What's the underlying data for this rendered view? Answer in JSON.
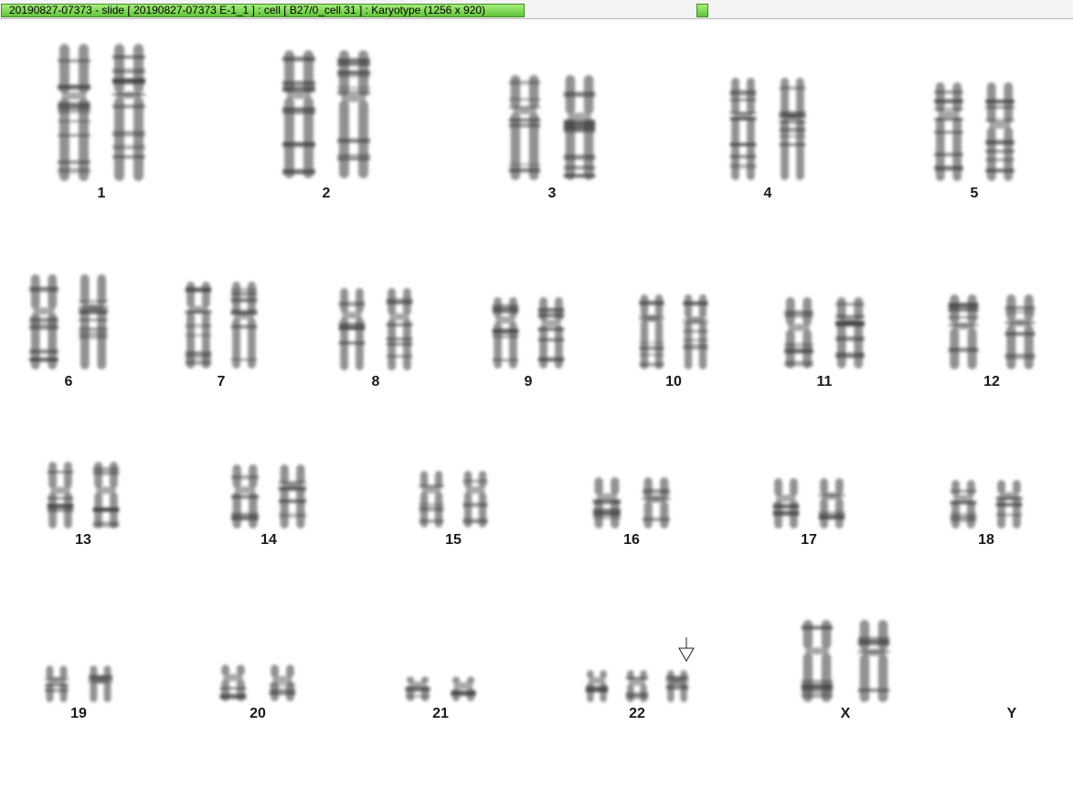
{
  "title_bar": {
    "text": "20190827-07373 - slide [ 20190827-07373 E-1_1 ] : cell [ B27/0_cell 31 ] : Karyotype  (1256 x 920)",
    "progress_color": "#6fd146"
  },
  "karyotype": {
    "pairs": [
      {
        "label": "1"
      },
      {
        "label": "2"
      },
      {
        "label": "3"
      },
      {
        "label": "4"
      },
      {
        "label": "5"
      },
      {
        "label": "6"
      },
      {
        "label": "7"
      },
      {
        "label": "8"
      },
      {
        "label": "9"
      },
      {
        "label": "10"
      },
      {
        "label": "11"
      },
      {
        "label": "12"
      },
      {
        "label": "13"
      },
      {
        "label": "14"
      },
      {
        "label": "15"
      },
      {
        "label": "16"
      },
      {
        "label": "17"
      },
      {
        "label": "18"
      },
      {
        "label": "19"
      },
      {
        "label": "20"
      },
      {
        "label": "21"
      },
      {
        "label": "22"
      },
      {
        "label": "X"
      },
      {
        "label": "Y"
      }
    ],
    "chromosome_color": "#6e6e6e",
    "band_color": "#3a3a3a",
    "marker_icon": "down-arrow-icon"
  }
}
